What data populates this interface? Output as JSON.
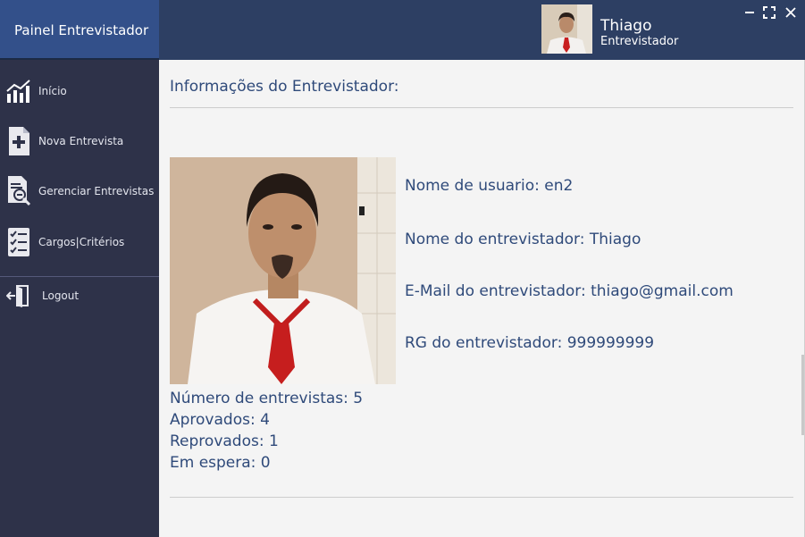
{
  "app": {
    "title": "Painel Entrevistador"
  },
  "user": {
    "name": "Thiago",
    "role": "Entrevistador"
  },
  "window_controls": {
    "minimize": "–",
    "maximize": "⛶",
    "close": "✕"
  },
  "sidebar": {
    "items": [
      {
        "label": "Início",
        "icon": "chart-icon"
      },
      {
        "label": "Nova Entrevista",
        "icon": "add-document-icon"
      },
      {
        "label": "Gerenciar Entrevistas",
        "icon": "search-document-icon"
      },
      {
        "label": "Cargos|Critérios",
        "icon": "checklist-icon"
      },
      {
        "label": "Logout",
        "icon": "logout-icon"
      }
    ]
  },
  "main": {
    "title": "Informações do Entrevistador:",
    "fields": {
      "username": "Nome de usuario: en2",
      "name": "Nome do entrevistador: Thiago",
      "email": "E-Mail do entrevistador: thiago@gmail.com",
      "rg": "RG do entrevistador: 999999999"
    },
    "stats": {
      "total": "Número de entrevistas: 5",
      "approved": "Aprovados: 4",
      "rejected": "Reprovados: 1",
      "waiting": "Em espera: 0"
    }
  },
  "colors": {
    "header": "#2d3f63",
    "brand": "#33508a",
    "sidebar": "#2e3249",
    "text_accent": "#2f4a7a",
    "background": "#f4f4f4"
  }
}
